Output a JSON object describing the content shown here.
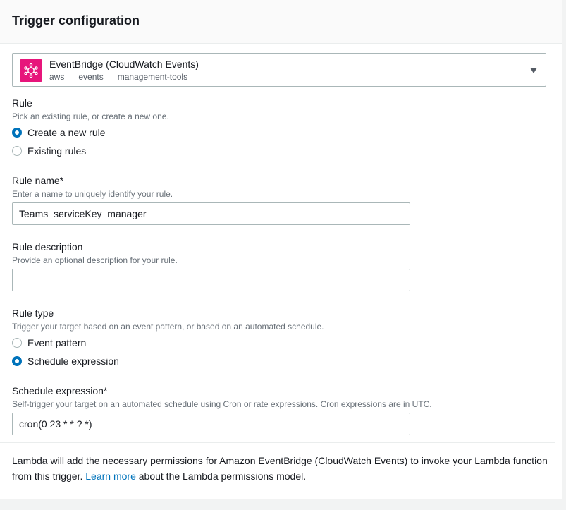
{
  "panel": {
    "title": "Trigger configuration"
  },
  "source": {
    "name": "EventBridge (CloudWatch Events)",
    "tags": [
      "aws",
      "events",
      "management-tools"
    ],
    "icon": "eventbridge-icon",
    "icon_color": "#e7157b"
  },
  "rule": {
    "label": "Rule",
    "description": "Pick an existing rule, or create a new one.",
    "options": [
      {
        "label": "Create a new rule",
        "checked": true
      },
      {
        "label": "Existing rules",
        "checked": false
      }
    ]
  },
  "rule_name": {
    "label": "Rule name*",
    "description": "Enter a name to uniquely identify your rule.",
    "value": "Teams_serviceKey_manager"
  },
  "rule_description": {
    "label": "Rule description",
    "description": "Provide an optional description for your rule.",
    "value": ""
  },
  "rule_type": {
    "label": "Rule type",
    "description": "Trigger your target based on an event pattern, or based on an automated schedule.",
    "options": [
      {
        "label": "Event pattern",
        "checked": false
      },
      {
        "label": "Schedule expression",
        "checked": true
      }
    ]
  },
  "schedule": {
    "label": "Schedule expression*",
    "description": "Self-trigger your target on an automated schedule using Cron or rate expressions. Cron expressions are in UTC.",
    "value": "cron(0 23 * * ? *)"
  },
  "info": {
    "text_before": "Lambda will add the necessary permissions for Amazon EventBridge (CloudWatch Events) to invoke your Lambda function from this trigger.",
    "link": "Learn more",
    "text_after": "about the Lambda permissions model."
  },
  "colors": {
    "accent": "#0073bb",
    "border": "#aab7b8"
  }
}
